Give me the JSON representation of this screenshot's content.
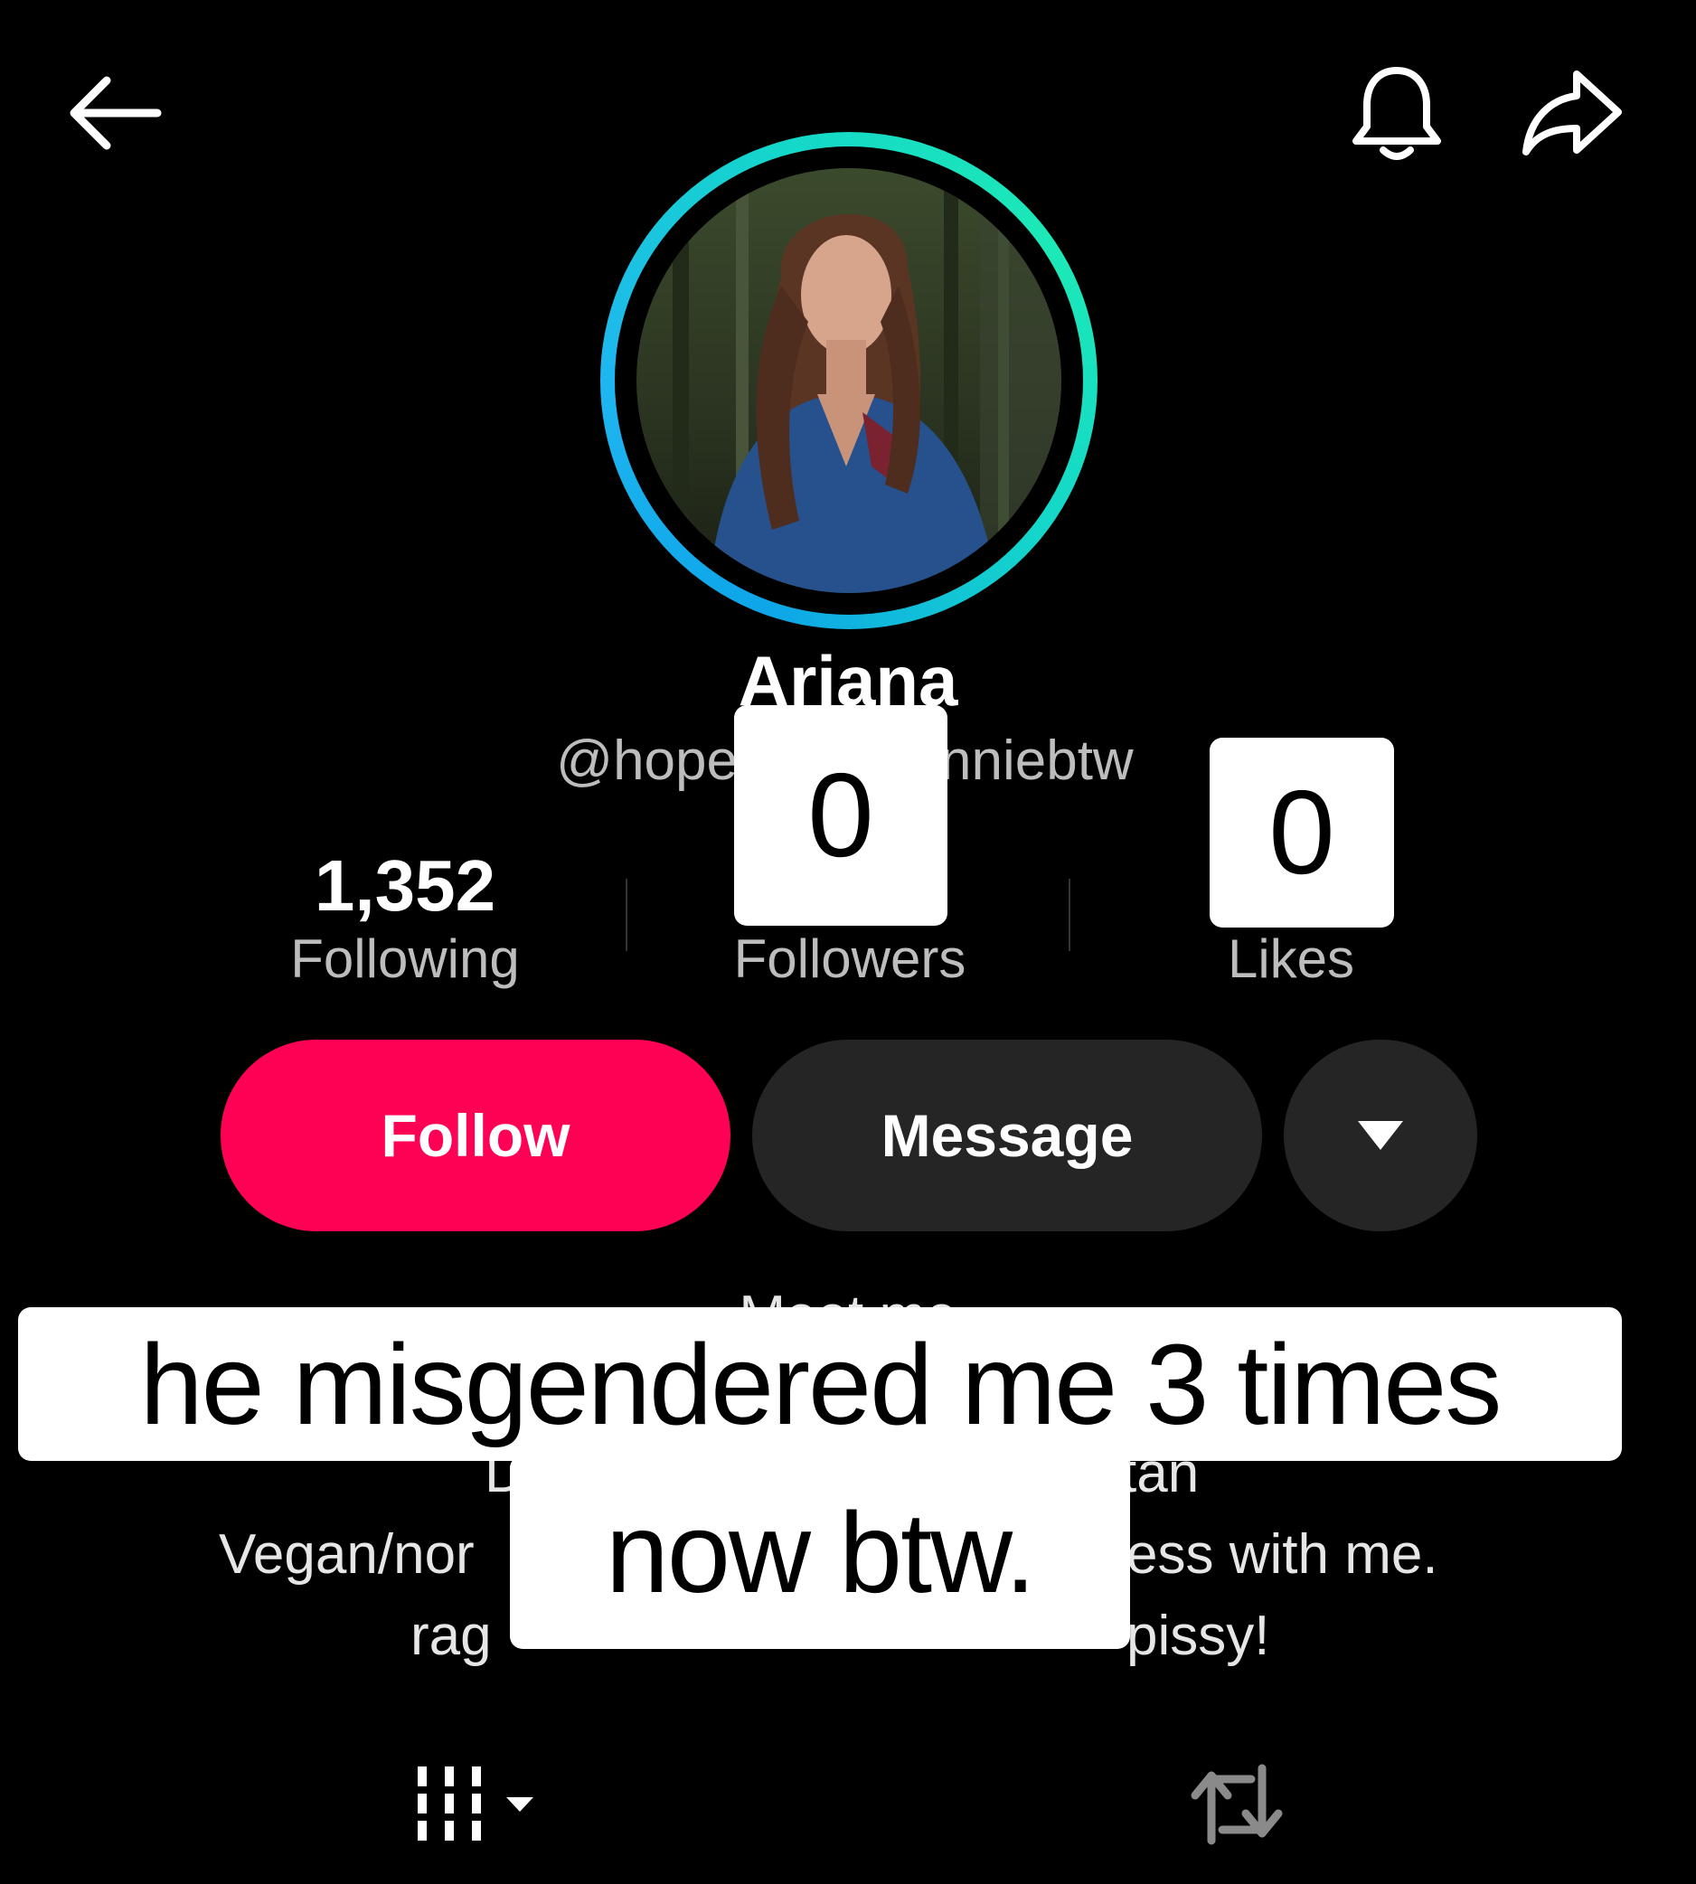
{
  "header": {
    "back_icon": "arrow-left-icon",
    "bell_icon": "bell-icon",
    "share_icon": "share-arrow-icon"
  },
  "profile": {
    "name": "Ariana",
    "handle_left": "@hope",
    "handle_right": "nniebtw",
    "avatar_ring_colors": [
      "#0ea5e9",
      "#1de9b6"
    ]
  },
  "stats": [
    {
      "value": "1,352",
      "label": "Following"
    },
    {
      "value": "",
      "label": "Followers"
    },
    {
      "value": "",
      "label": "Likes"
    }
  ],
  "stickers": {
    "followers_value": "0",
    "likes_value": "0"
  },
  "actions": {
    "follow_label": "Follow",
    "message_label": "Message",
    "more_icon": "caret-down-icon",
    "follow_color": "#fe0154",
    "secondary_color": "#252525"
  },
  "bio": {
    "line0": "Meet me",
    "line1_left": "D",
    "line1_right": "tan",
    "line2_left": "Vegan/nor",
    "line2_right": "ess with me.",
    "line3_left": "rag",
    "line3_right": "pissy!"
  },
  "caption": {
    "line1": "he misgendered me 3 times",
    "line2": "now btw."
  },
  "tabs": {
    "videos_icon": "grid-columns-icon",
    "repost_icon": "repost-icon"
  }
}
